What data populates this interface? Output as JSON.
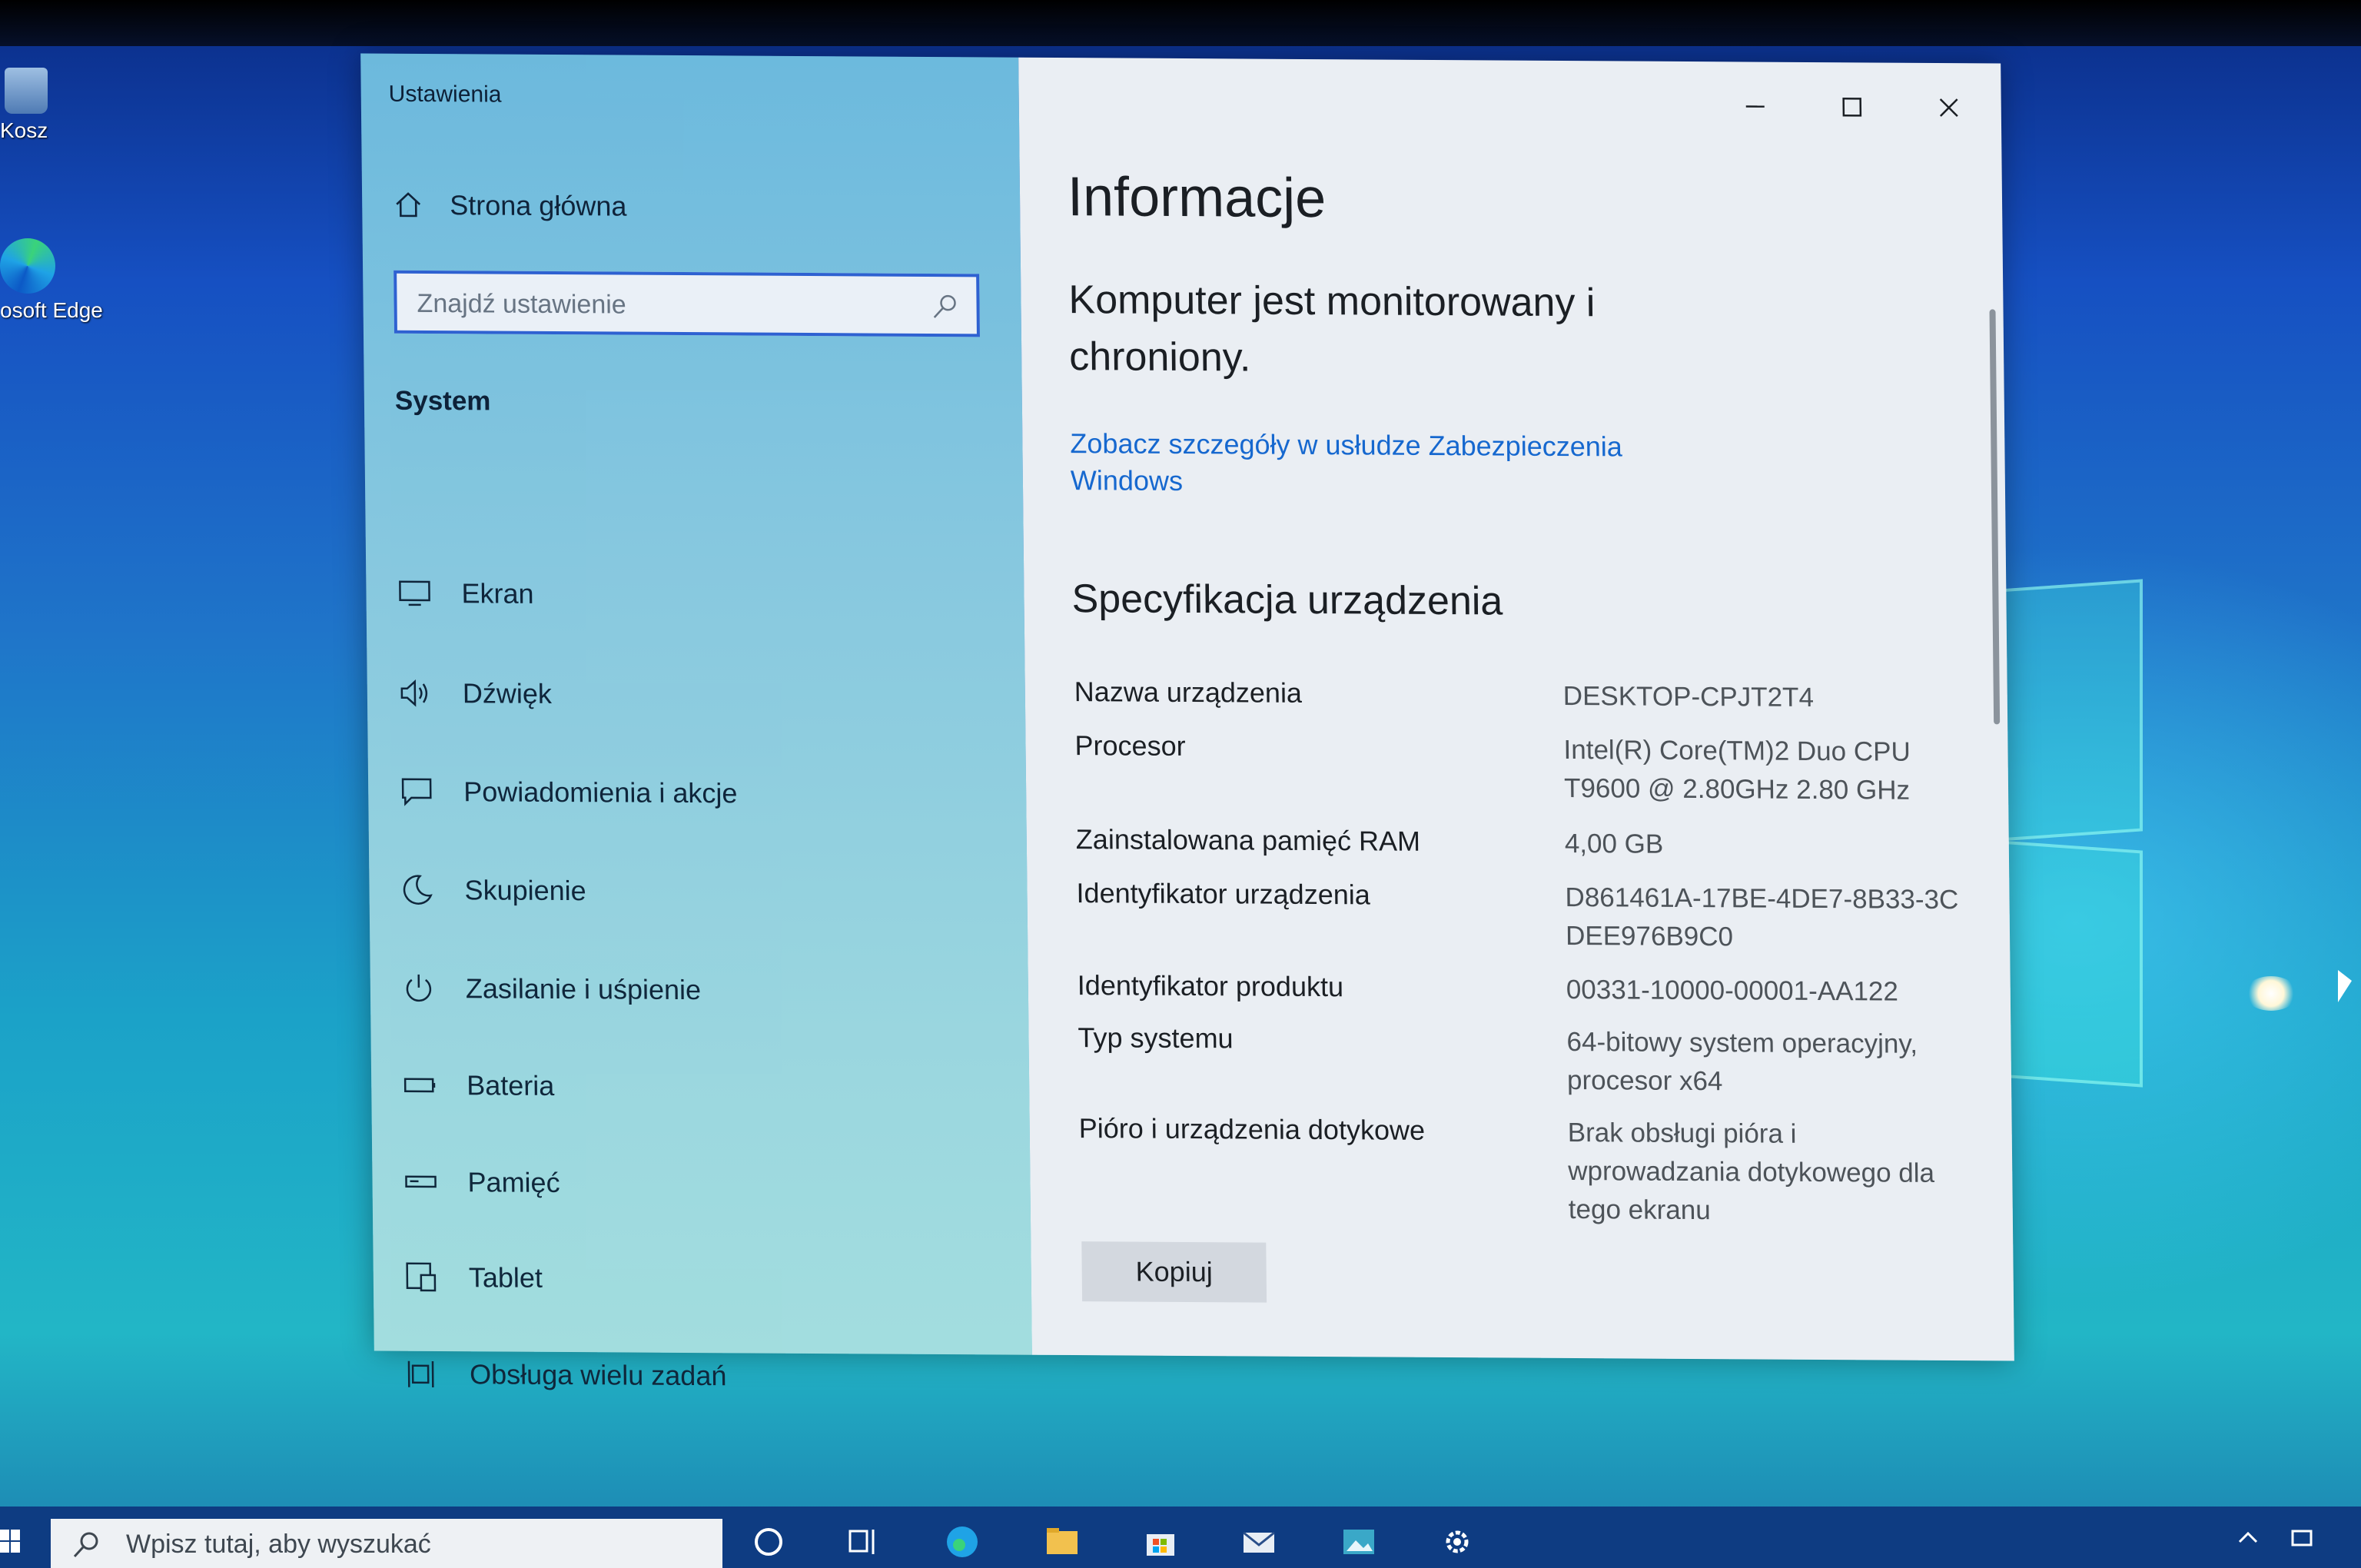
{
  "desktop": {
    "icons": [
      {
        "label": "Kosz",
        "icon": "recycle-bin-icon"
      },
      {
        "label": "osoft Edge",
        "icon": "edge-icon"
      }
    ]
  },
  "window": {
    "title": "Ustawienia",
    "sidebar": {
      "home_label": "Strona główna",
      "search_placeholder": "Znajdź ustawienie",
      "section": "System",
      "items": [
        {
          "label": "Ekran",
          "icon": "monitor-icon"
        },
        {
          "label": "Dźwięk",
          "icon": "speaker-icon"
        },
        {
          "label": "Powiadomienia i akcje",
          "icon": "notification-icon"
        },
        {
          "label": "Skupienie",
          "icon": "moon-icon"
        },
        {
          "label": "Zasilanie i uśpienie",
          "icon": "power-icon"
        },
        {
          "label": "Bateria",
          "icon": "battery-icon"
        },
        {
          "label": "Pamięć",
          "icon": "storage-icon"
        },
        {
          "label": "Tablet",
          "icon": "tablet-icon"
        },
        {
          "label": "Obsługa wielu zadań",
          "icon": "multitasking-icon"
        }
      ]
    },
    "content": {
      "title": "Informacje",
      "status": "Komputer jest monitorowany i chroniony.",
      "security_link": "Zobacz szczegóły w usłudze Zabezpieczenia Windows",
      "spec_title": "Specyfikacja urządzenia",
      "specs": [
        {
          "label": "Nazwa urządzenia",
          "value": "DESKTOP-CPJT2T4"
        },
        {
          "label": "Procesor",
          "value": "Intel(R) Core(TM)2 Duo CPU T9600 @ 2.80GHz 2.80 GHz"
        },
        {
          "label": "Zainstalowana pamięć RAM",
          "value": "4,00 GB"
        },
        {
          "label": "Identyfikator urządzenia",
          "value": "D861461A-17BE-4DE7-8B33-3CDEE976B9C0"
        },
        {
          "label": "Identyfikator produktu",
          "value": "00331-10000-00001-AA122"
        },
        {
          "label": "Typ systemu",
          "value": "64-bitowy system operacyjny, procesor x64"
        },
        {
          "label": "Pióro i urządzenia dotykowe",
          "value": "Brak obsługi pióra i wprowadzania dotykowego dla tego ekranu"
        }
      ],
      "copy_button": "Kopiuj"
    }
  },
  "taskbar": {
    "search_placeholder": "Wpisz tutaj, aby wyszukać",
    "icons": [
      "cortana-icon",
      "task-view-icon",
      "edge-icon",
      "file-explorer-icon",
      "store-icon",
      "mail-icon",
      "photos-icon",
      "settings-icon"
    ]
  },
  "colors": {
    "accent": "#2f62d2",
    "link": "#1668cf",
    "taskbar": "#0e3c82"
  }
}
